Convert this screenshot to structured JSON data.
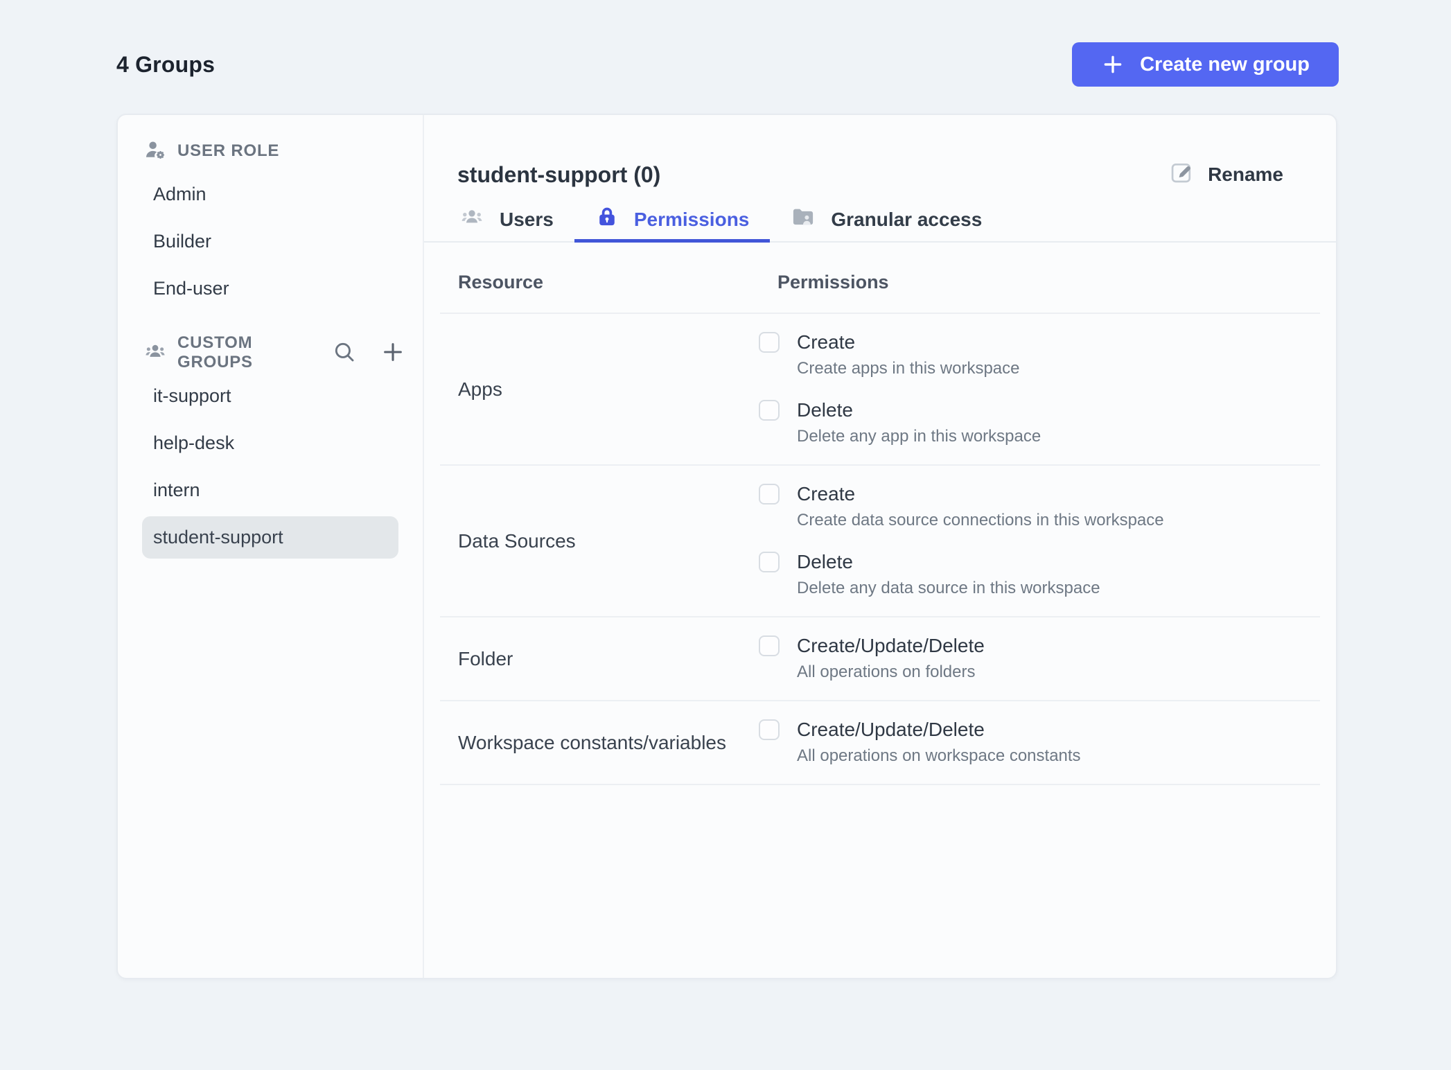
{
  "page": {
    "title": "4 Groups"
  },
  "topbar": {
    "create_button_label": "Create new group"
  },
  "colors": {
    "accent_blue": "#4a5fe0",
    "tab_underline_blue": "#4156d8",
    "button_blue": "#5467f2",
    "page_background": "#eff3f7",
    "card_background": "#fbfcfd",
    "selected_item_background": "#e3e7ea"
  },
  "sidebar": {
    "sections": [
      {
        "title": "USER ROLE",
        "icon": "user-gear-icon",
        "items": [
          {
            "label": "Admin",
            "selected": false
          },
          {
            "label": "Builder",
            "selected": false
          },
          {
            "label": "End-user",
            "selected": false
          }
        ]
      },
      {
        "title": "CUSTOM GROUPS",
        "icon": "users-icon",
        "actions": [
          "search-icon",
          "plus-icon"
        ],
        "items": [
          {
            "label": "it-support",
            "selected": false
          },
          {
            "label": "help-desk",
            "selected": false
          },
          {
            "label": "intern",
            "selected": false
          },
          {
            "label": "student-support",
            "selected": true
          }
        ]
      }
    ]
  },
  "main": {
    "title": "student-support (0)",
    "rename_label": "Rename",
    "tabs": [
      {
        "label": "Users",
        "icon": "users-icon",
        "active": false
      },
      {
        "label": "Permissions",
        "icon": "lock-icon",
        "active": true
      },
      {
        "label": "Granular access",
        "icon": "folder-user-icon",
        "active": false
      }
    ],
    "table": {
      "columns": [
        "Resource",
        "Permissions"
      ],
      "rows": [
        {
          "resource": "Apps",
          "permissions": [
            {
              "label": "Create",
              "description": "Create apps in this workspace",
              "checked": false
            },
            {
              "label": "Delete",
              "description": "Delete any app in this workspace",
              "checked": false
            }
          ]
        },
        {
          "resource": "Data Sources",
          "permissions": [
            {
              "label": "Create",
              "description": "Create data source connections in this workspace",
              "checked": false
            },
            {
              "label": "Delete",
              "description": "Delete any data source in this workspace",
              "checked": false
            }
          ]
        },
        {
          "resource": "Folder",
          "permissions": [
            {
              "label": "Create/Update/Delete",
              "description": "All operations on folders",
              "checked": false
            }
          ]
        },
        {
          "resource": "Workspace constants/variables",
          "permissions": [
            {
              "label": "Create/Update/Delete",
              "description": "All operations on workspace constants",
              "checked": false
            }
          ]
        }
      ]
    }
  }
}
